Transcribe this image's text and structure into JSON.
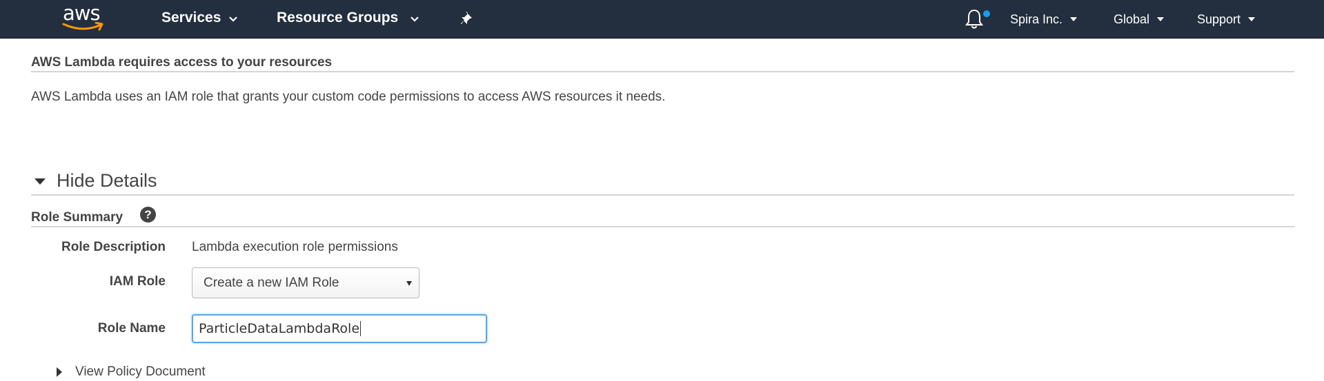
{
  "nav": {
    "logo_text": "aws",
    "services": "Services",
    "resource_groups": "Resource Groups",
    "account": "Spira Inc.",
    "region": "Global",
    "support": "Support",
    "colors": {
      "bar": "#232f3e",
      "logo_smile": "#f90",
      "notification_dot": "#1a9bf0"
    },
    "icons": [
      "chevron-down-icon",
      "pin-icon",
      "bell-icon",
      "caret-down-icon"
    ]
  },
  "access": {
    "title": "AWS Lambda requires access to your resources",
    "description": "AWS Lambda uses an IAM role that grants your custom code permissions to access AWS resources it needs."
  },
  "details": {
    "toggle_label": "Hide Details",
    "summary_title": "Role Summary",
    "help_glyph": "?",
    "role_description_label": "Role Description",
    "role_description_value": "Lambda execution role permissions",
    "iam_role_label": "IAM Role",
    "iam_role_selected": "Create a new IAM Role",
    "role_name_label": "Role Name",
    "role_name_value": "ParticleDataLambdaRole",
    "policy_link": "View Policy Document"
  }
}
